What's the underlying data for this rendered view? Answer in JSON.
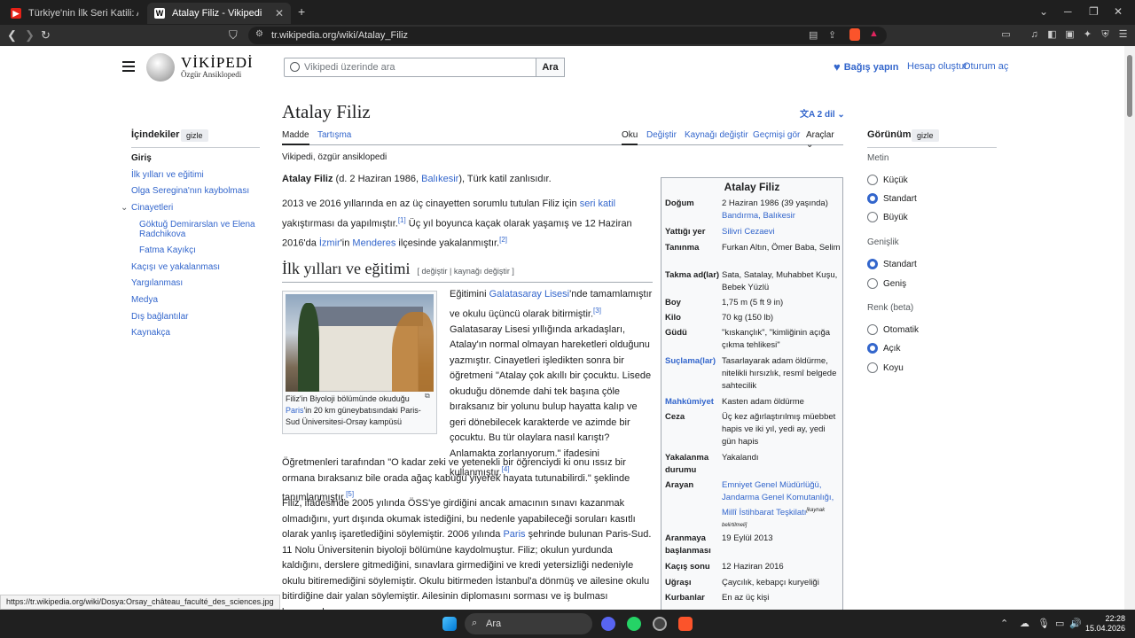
{
  "browser": {
    "tabs": [
      {
        "label": "Türkiye'nin İlk Seri Katili: Atalay Filiz"
      },
      {
        "label": "Atalay Filiz - Vikipedi"
      }
    ],
    "url": "tr.wikipedia.org/wiki/Atalay_Filiz"
  },
  "header": {
    "wordmark": "VİKİPEDİ",
    "tagline": "Özgür Ansiklopedi",
    "search_placeholder": "Vikipedi üzerinde ara",
    "search_button": "Ara",
    "donate": "Bağış yapın",
    "create_account": "Hesap oluştur",
    "login": "Oturum aç"
  },
  "toc": {
    "title": "İçindekiler",
    "hide": "gizle",
    "items": [
      "Giriş",
      "İlk yılları ve eğitimi",
      "Olga Seregina'nın kaybolması",
      "Cinayetleri",
      "Göktuğ Demirarslan ve Elena Radchikova",
      "Fatma Kayıkçı",
      "Kaçışı ve yakalanması",
      "Yargılanması",
      "Medya",
      "Dış bağlantılar",
      "Kaynakça"
    ]
  },
  "article": {
    "title": "Atalay Filiz",
    "languages": "2 dil",
    "tabs": {
      "madde": "Madde",
      "tartisma": "Tartışma",
      "oku": "Oku",
      "degistir": "Değiştir",
      "kaynagi": "Kaynağı değiştir",
      "gecmis": "Geçmişi gör",
      "araclar": "Araçlar"
    },
    "from": "Vikipedi, özgür ansiklopedi",
    "p1": {
      "bold": "Atalay Filiz",
      "a": " (d. 2 Haziran 1986, ",
      "link": "Balıkesir",
      "b": "), Türk katil zanlısıdır."
    },
    "p2": {
      "a": "2013 ve 2016 yıllarında en az üç cinayetten sorumlu tutulan Filiz için ",
      "l1": "seri katil",
      "b": " yakıştırması da yapılmıştır.",
      "r1": "[1]",
      "c": " Üç yıl boyunca kaçak olarak yaşamış ve 12 Haziran 2016'da ",
      "l2": "İzmir",
      "d": "'in ",
      "l3": "Menderes",
      "e": " ilçesinde yakalanmıştır.",
      "r2": "[2]"
    },
    "h2": "İlk yılları ve eğitimi",
    "h2_edit": "[ değiştir | kaynağı değiştir ]",
    "caption": {
      "a": "Filiz'in Biyoloji bölümünde okuduğu ",
      "link": "Paris",
      "b": "'in 20 km güneybatısındaki Paris-Sud Üniversitesi-Orsay kampüsü"
    },
    "p3": {
      "a": "Eğitimini ",
      "link": "Galatasaray Lisesi",
      "b": "'nde tamamlamıştır ve okulu üçüncü olarak bitirmiştir.",
      "r3": "[3]",
      "c": " Galatasaray Lisesi yıllığında arkadaşları, Atalay'ın normal olmayan hareketleri olduğunu yazmıştır. Cinayetleri işledikten sonra bir öğretmeni \"Atalay çok akıllı bir çocuktu. Lisede okuduğu dönemde dahi tek başına çöle bıraksanız bir yolunu bulup hayatta kalıp ve geri dönebilecek karakterde ve azimde bir çocuktu. Bu tür olaylara nasıl karıştı? Anlamakta zorlanıyorum.\" ifadesini kullanmıştır.",
      "r4": "[4]",
      "d": " Öğretmenleri tarafından \"O kadar zeki ve yetenekli bir öğrenciydi ki onu ıssız bir ormana bıraksanız bile orada ağaç kabuğu yiyerek hayata tutunabilirdi.\" şeklinde tanımlanmıştır.",
      "r5": "[5]"
    },
    "p4": {
      "a": "Filiz, ifadesinde 2005 yılında ÖSS'ye girdiğini ancak amacının sınavı kazanmak olmadığını, yurt dışında okumak istediğini, bu nedenle yapabileceği soruları kasıtlı olarak yanlış işaretlediğini söylemiştir. 2006 yılında ",
      "link": "Paris",
      "b": " şehrinde bulunan Paris-Sud. 11 Nolu Üniversitenin biyoloji bölümüne kaydolmuştur. Filiz; okulun yurdunda kaldığını, derslere gitmediğini, sınavlara girmediğini ve kredi yetersizliği nedeniyle okulu bitiremediğini söylemiştir. Okulu bitirmeden İstanbul'a dönmüş ve ailesine okulu bitirdiğine dair yalan söylemiştir. Ailesinin diplomasını sorması ve iş bulması konusunda"
    }
  },
  "infobox": {
    "title": "Atalay Filiz",
    "rows": [
      {
        "k": "Doğum",
        "v": "2 Haziran 1986 (39 yaşında)",
        "v2": "Bandırma, Balıkesir"
      },
      {
        "k": "Yattığı yer",
        "v": "Silivri Cezaevi"
      },
      {
        "k": "Tanınma",
        "v": "Furkan Altın, Ömer Baba, Selim"
      },
      {
        "k": "Takma ad(lar)",
        "v": "Sata, Satalay, Muhabbet Kuşu, Bebek Yüzlü"
      },
      {
        "k": "Boy",
        "v": "1,75 m (5 ft 9 in)"
      },
      {
        "k": "Kilo",
        "v": "70 kg (150 lb)"
      },
      {
        "k": "Güdü",
        "v": "\"kıskançlık\", \"kimliğinin açığa çıkma tehlikesi\""
      },
      {
        "k": "Suçlama(lar)",
        "v": "Tasarlayarak adam öldürme, nitelikli hırsızlık, resmî belgede sahtecilik"
      },
      {
        "k": "Mahkûmiyet",
        "v": "Kasten adam öldürme"
      },
      {
        "k": "Ceza",
        "v": "Üç kez ağırlaştırılmış müebbet hapis ve iki yıl, yedi ay, yedi gün hapis"
      },
      {
        "k": "Yakalanma durumu",
        "v": "Yakalandı"
      },
      {
        "k": "Arayan",
        "v": "Emniyet Genel Müdürlüğü, Jandarma Genel Komutanlığı, Millî İstihbarat Teşkilatı",
        "note": "[kaynak belirtilmeli]"
      },
      {
        "k": "Aranmaya başlanması",
        "v": "19 Eylül 2013"
      },
      {
        "k": "Kaçış sonu",
        "v": "12 Haziran 2016"
      },
      {
        "k": "Uğraşı",
        "v": "Çaycılık, kebapçı kuryeliği"
      },
      {
        "k": "Kurbanlar",
        "v": "En az üç kişi"
      }
    ]
  },
  "appearance": {
    "title": "Görünüm",
    "hide": "gizle",
    "text_label": "Metin",
    "text_opts": [
      "Küçük",
      "Standart",
      "Büyük"
    ],
    "width_label": "Genişlik",
    "width_opts": [
      "Standart",
      "Geniş"
    ],
    "color_label": "Renk (beta)",
    "color_opts": [
      "Otomatik",
      "Açık",
      "Koyu"
    ]
  },
  "status_url": "https://tr.wikipedia.org/wiki/Dosya:Orsay_château_faculté_des_sciences.jpg",
  "taskbar": {
    "search": "Ara",
    "time": "22:28",
    "date": "15.04.2026"
  }
}
